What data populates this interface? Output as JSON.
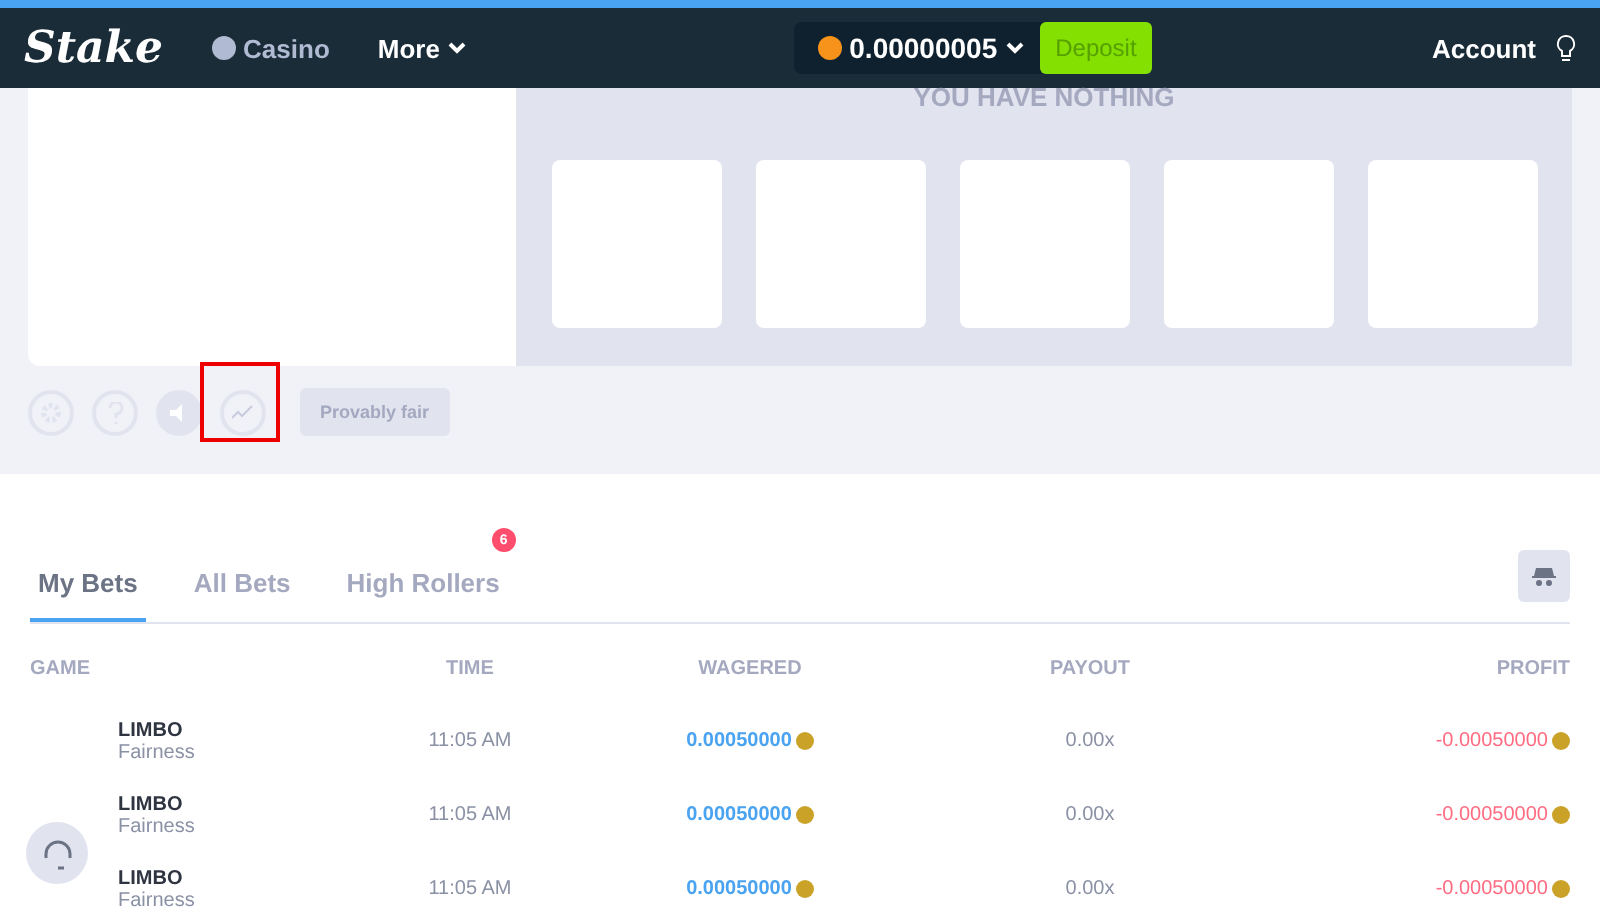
{
  "nav": {
    "logo": "Stake",
    "casino": "Casino",
    "more": "More",
    "balance": "0.00000005",
    "deposit": "Deposit",
    "account": "Account"
  },
  "game": {
    "title": "YOU HAVE NOTHING",
    "slots": [
      {
        "kind": "empty"
      },
      {
        "kind": "empty"
      },
      {
        "kind": "empty"
      },
      {
        "kind": "empty"
      },
      {
        "kind": "empty"
      }
    ],
    "provably_fair": "Provably fair",
    "highlighted": true
  },
  "tabs": [
    {
      "label": "My Bets",
      "selected": true
    },
    {
      "label": "All Bets",
      "selected": false
    },
    {
      "label": "High Rollers",
      "selected": false,
      "badge": "6"
    }
  ],
  "table": {
    "columns": [
      "GAME",
      "TIME",
      "WAGERED",
      "PAYOUT",
      "PROFIT"
    ],
    "rows": [
      {
        "game": "LIMBO",
        "sub": "Fairness",
        "time": "11:05 AM",
        "wagered": "0.00050000",
        "payout": "0.00x",
        "profit": "-0.00050000"
      },
      {
        "game": "LIMBO",
        "sub": "Fairness",
        "time": "11:05 AM",
        "wagered": "0.00050000",
        "payout": "0.00x",
        "profit": "-0.00050000"
      },
      {
        "game": "LIMBO",
        "sub": "Fairness",
        "time": "11:05 AM",
        "wagered": "0.00050000",
        "payout": "0.00x",
        "profit": "-0.00050000"
      }
    ]
  }
}
